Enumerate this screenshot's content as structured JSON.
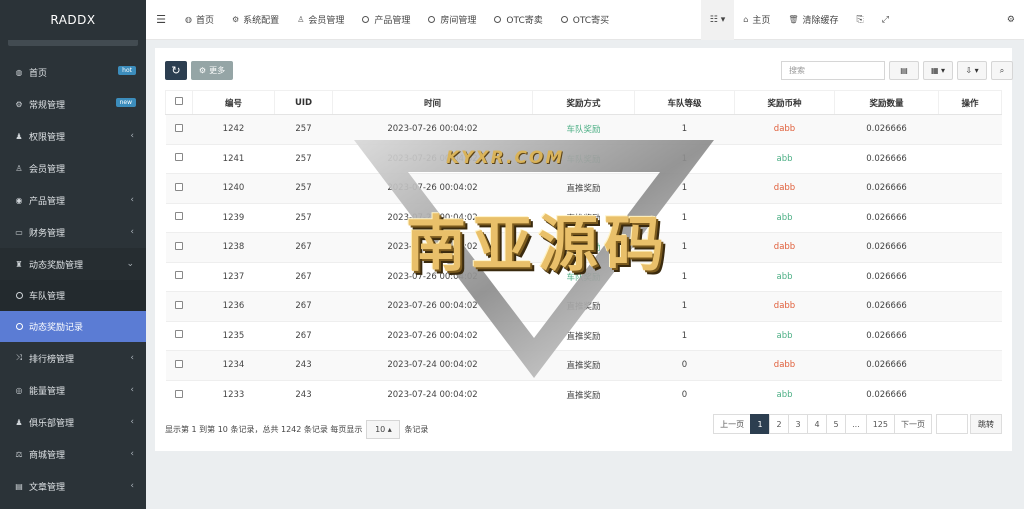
{
  "app": {
    "brand": "RADDX"
  },
  "sidebar": {
    "items": [
      {
        "label": "首页",
        "icon": "dashboard-icon",
        "glyph": "◍",
        "badge": "hot"
      },
      {
        "label": "常规管理",
        "icon": "cogs-icon",
        "glyph": "⚙",
        "badge": "new"
      },
      {
        "label": "权限管理",
        "icon": "users-icon",
        "glyph": "♟",
        "caret": "‹"
      },
      {
        "label": "会员管理",
        "icon": "user-icon",
        "glyph": "♙"
      },
      {
        "label": "产品管理",
        "icon": "product-icon",
        "glyph": "◉",
        "caret": "‹"
      },
      {
        "label": "财务管理",
        "icon": "card-icon",
        "glyph": "▭",
        "caret": "‹"
      },
      {
        "label": "动态奖励管理",
        "icon": "trophy-icon",
        "glyph": "♜",
        "caret": "⌄"
      }
    ],
    "subitems": [
      {
        "label": "车队管理"
      },
      {
        "label": "动态奖励记录"
      }
    ],
    "items_after": [
      {
        "label": "排行榜管理",
        "icon": "random-icon",
        "glyph": "⤨",
        "caret": "‹"
      },
      {
        "label": "能量管理",
        "icon": "bolt-circle-icon",
        "glyph": "◎",
        "caret": "‹"
      },
      {
        "label": "俱乐部管理",
        "icon": "group-icon",
        "glyph": "♟",
        "caret": "‹"
      },
      {
        "label": "商城管理",
        "icon": "balance-icon",
        "glyph": "⚖",
        "caret": "‹"
      },
      {
        "label": "文章管理",
        "icon": "keyboard-icon",
        "glyph": "▤",
        "caret": "‹"
      }
    ]
  },
  "topbar": {
    "tabs": [
      {
        "label": "首页",
        "icon": "dashboard-icon",
        "glyph": "◍"
      },
      {
        "label": "系统配置",
        "icon": "gear-icon",
        "glyph": "⚙"
      },
      {
        "label": "会员管理",
        "icon": "user-icon",
        "glyph": "♙"
      },
      {
        "label": "产品管理",
        "icon": "circle-icon"
      },
      {
        "label": "房间管理",
        "icon": "circle-icon"
      },
      {
        "label": "OTC寄卖",
        "icon": "circle-icon"
      },
      {
        "label": "OTC寄买",
        "icon": "circle-icon"
      }
    ],
    "right": {
      "home": "主页",
      "clear_cache": "清除缓存"
    }
  },
  "toolbar": {
    "more": "更多",
    "search_placeholder": "搜索"
  },
  "table": {
    "headers": [
      "编号",
      "UID",
      "时间",
      "奖励方式",
      "车队等级",
      "奖励币种",
      "奖励数量",
      "操作"
    ],
    "rows": [
      {
        "id": "1242",
        "uid": "257",
        "time": "2023-07-26 00:04:02",
        "method": "车队奖励",
        "level": "1",
        "coin": "dabb",
        "amount": "0.026666"
      },
      {
        "id": "1241",
        "uid": "257",
        "time": "2023-07-26 00:04:02",
        "method": "车队奖励",
        "level": "1",
        "coin": "abb",
        "amount": "0.026666"
      },
      {
        "id": "1240",
        "uid": "257",
        "time": "2023-07-26 00:04:02",
        "method": "直推奖励",
        "level": "1",
        "coin": "dabb",
        "amount": "0.026666"
      },
      {
        "id": "1239",
        "uid": "257",
        "time": "2023-07-26 00:04:02",
        "method": "直推奖励",
        "level": "1",
        "coin": "abb",
        "amount": "0.026666"
      },
      {
        "id": "1238",
        "uid": "267",
        "time": "2023-07-26 00:04:02",
        "method": "车队奖励",
        "level": "1",
        "coin": "dabb",
        "amount": "0.026666"
      },
      {
        "id": "1237",
        "uid": "267",
        "time": "2023-07-26 00:04:02",
        "method": "车队奖励",
        "level": "1",
        "coin": "abb",
        "amount": "0.026666"
      },
      {
        "id": "1236",
        "uid": "267",
        "time": "2023-07-26 00:04:02",
        "method": "直推奖励",
        "level": "1",
        "coin": "dabb",
        "amount": "0.026666"
      },
      {
        "id": "1235",
        "uid": "267",
        "time": "2023-07-26 00:04:02",
        "method": "直推奖励",
        "level": "1",
        "coin": "abb",
        "amount": "0.026666"
      },
      {
        "id": "1234",
        "uid": "243",
        "time": "2023-07-24 00:04:02",
        "method": "直推奖励",
        "level": "0",
        "coin": "dabb",
        "amount": "0.026666"
      },
      {
        "id": "1233",
        "uid": "243",
        "time": "2023-07-24 00:04:02",
        "method": "直推奖励",
        "level": "0",
        "coin": "abb",
        "amount": "0.026666"
      }
    ]
  },
  "footer": {
    "info_prefix": "显示第 1 到第 10 条记录，总共 1242 条记录 每页显示",
    "page_size": "10",
    "info_suffix": "条记录"
  },
  "pagination": {
    "prev": "上一页",
    "pages": [
      "1",
      "2",
      "3",
      "4",
      "5",
      "...",
      "125"
    ],
    "next": "下一页",
    "go": "跳转"
  },
  "watermark": {
    "subtitle": "KYXR.COM",
    "title": "南亚源码"
  },
  "colors": {
    "sidebar_bg": "#2b3338",
    "active_item": "#5b7cd4",
    "refresh_button": "#2c3e50",
    "coin_green": "#4caf85",
    "coin_red": "#e0603c"
  }
}
